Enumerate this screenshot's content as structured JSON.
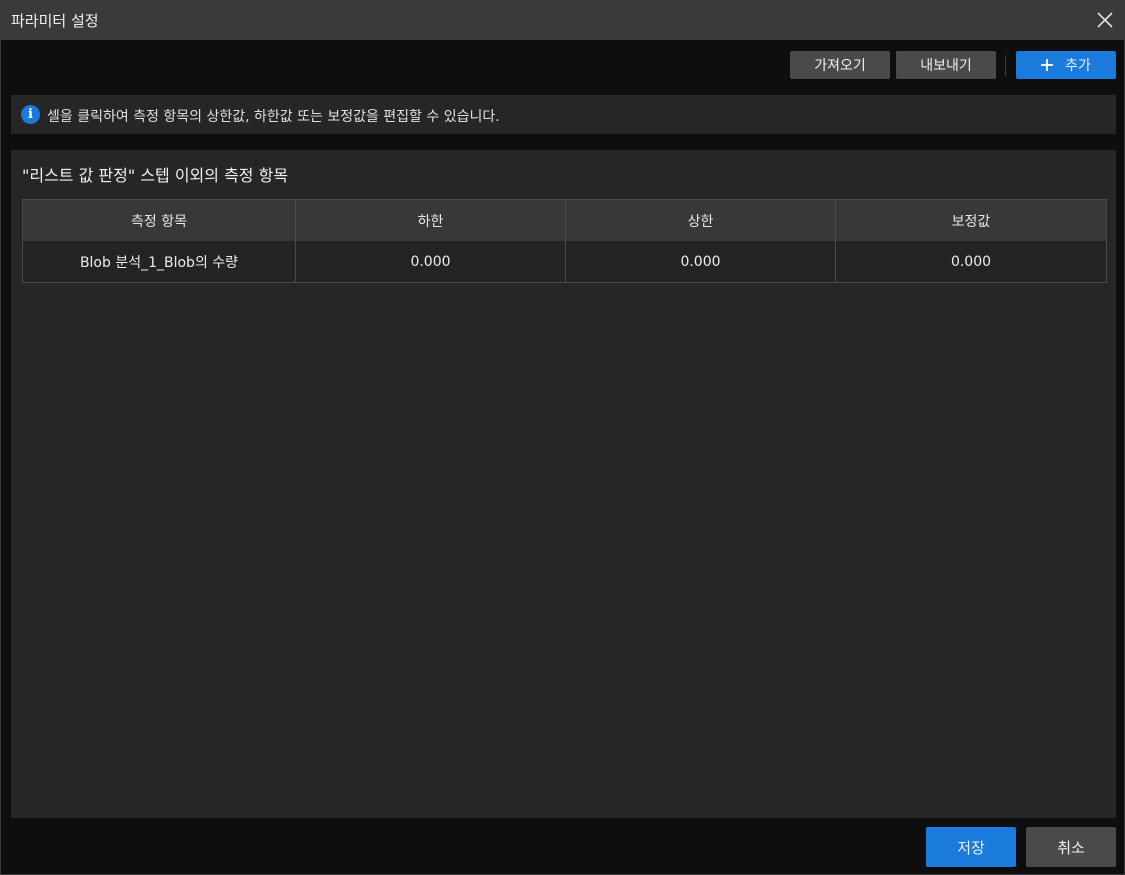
{
  "window": {
    "title": "파라미터 설정"
  },
  "toolbar": {
    "import_label": "가져오기",
    "export_label": "내보내기",
    "add_label": "추가"
  },
  "info": {
    "icon": "info-icon",
    "text": "셀을 클릭하여 측정 항목의 상한값, 하한값 또는 보정값을 편집할 수 있습니다."
  },
  "panel": {
    "title": "\"리스트 값 판정\" 스텝 이외의 측정 항목",
    "columns": [
      "측정 항목",
      "하한",
      "상한",
      "보정값"
    ],
    "rows": [
      [
        "Blob 분석_1_Blob의 수량",
        "0.000",
        "0.000",
        "0.000"
      ]
    ]
  },
  "footer": {
    "save_label": "저장",
    "cancel_label": "취소"
  },
  "colors": {
    "accent": "#1a7bdc",
    "titlebar": "#3a3a3a",
    "panel": "#262626",
    "button_gray": "#4a4a4a"
  }
}
